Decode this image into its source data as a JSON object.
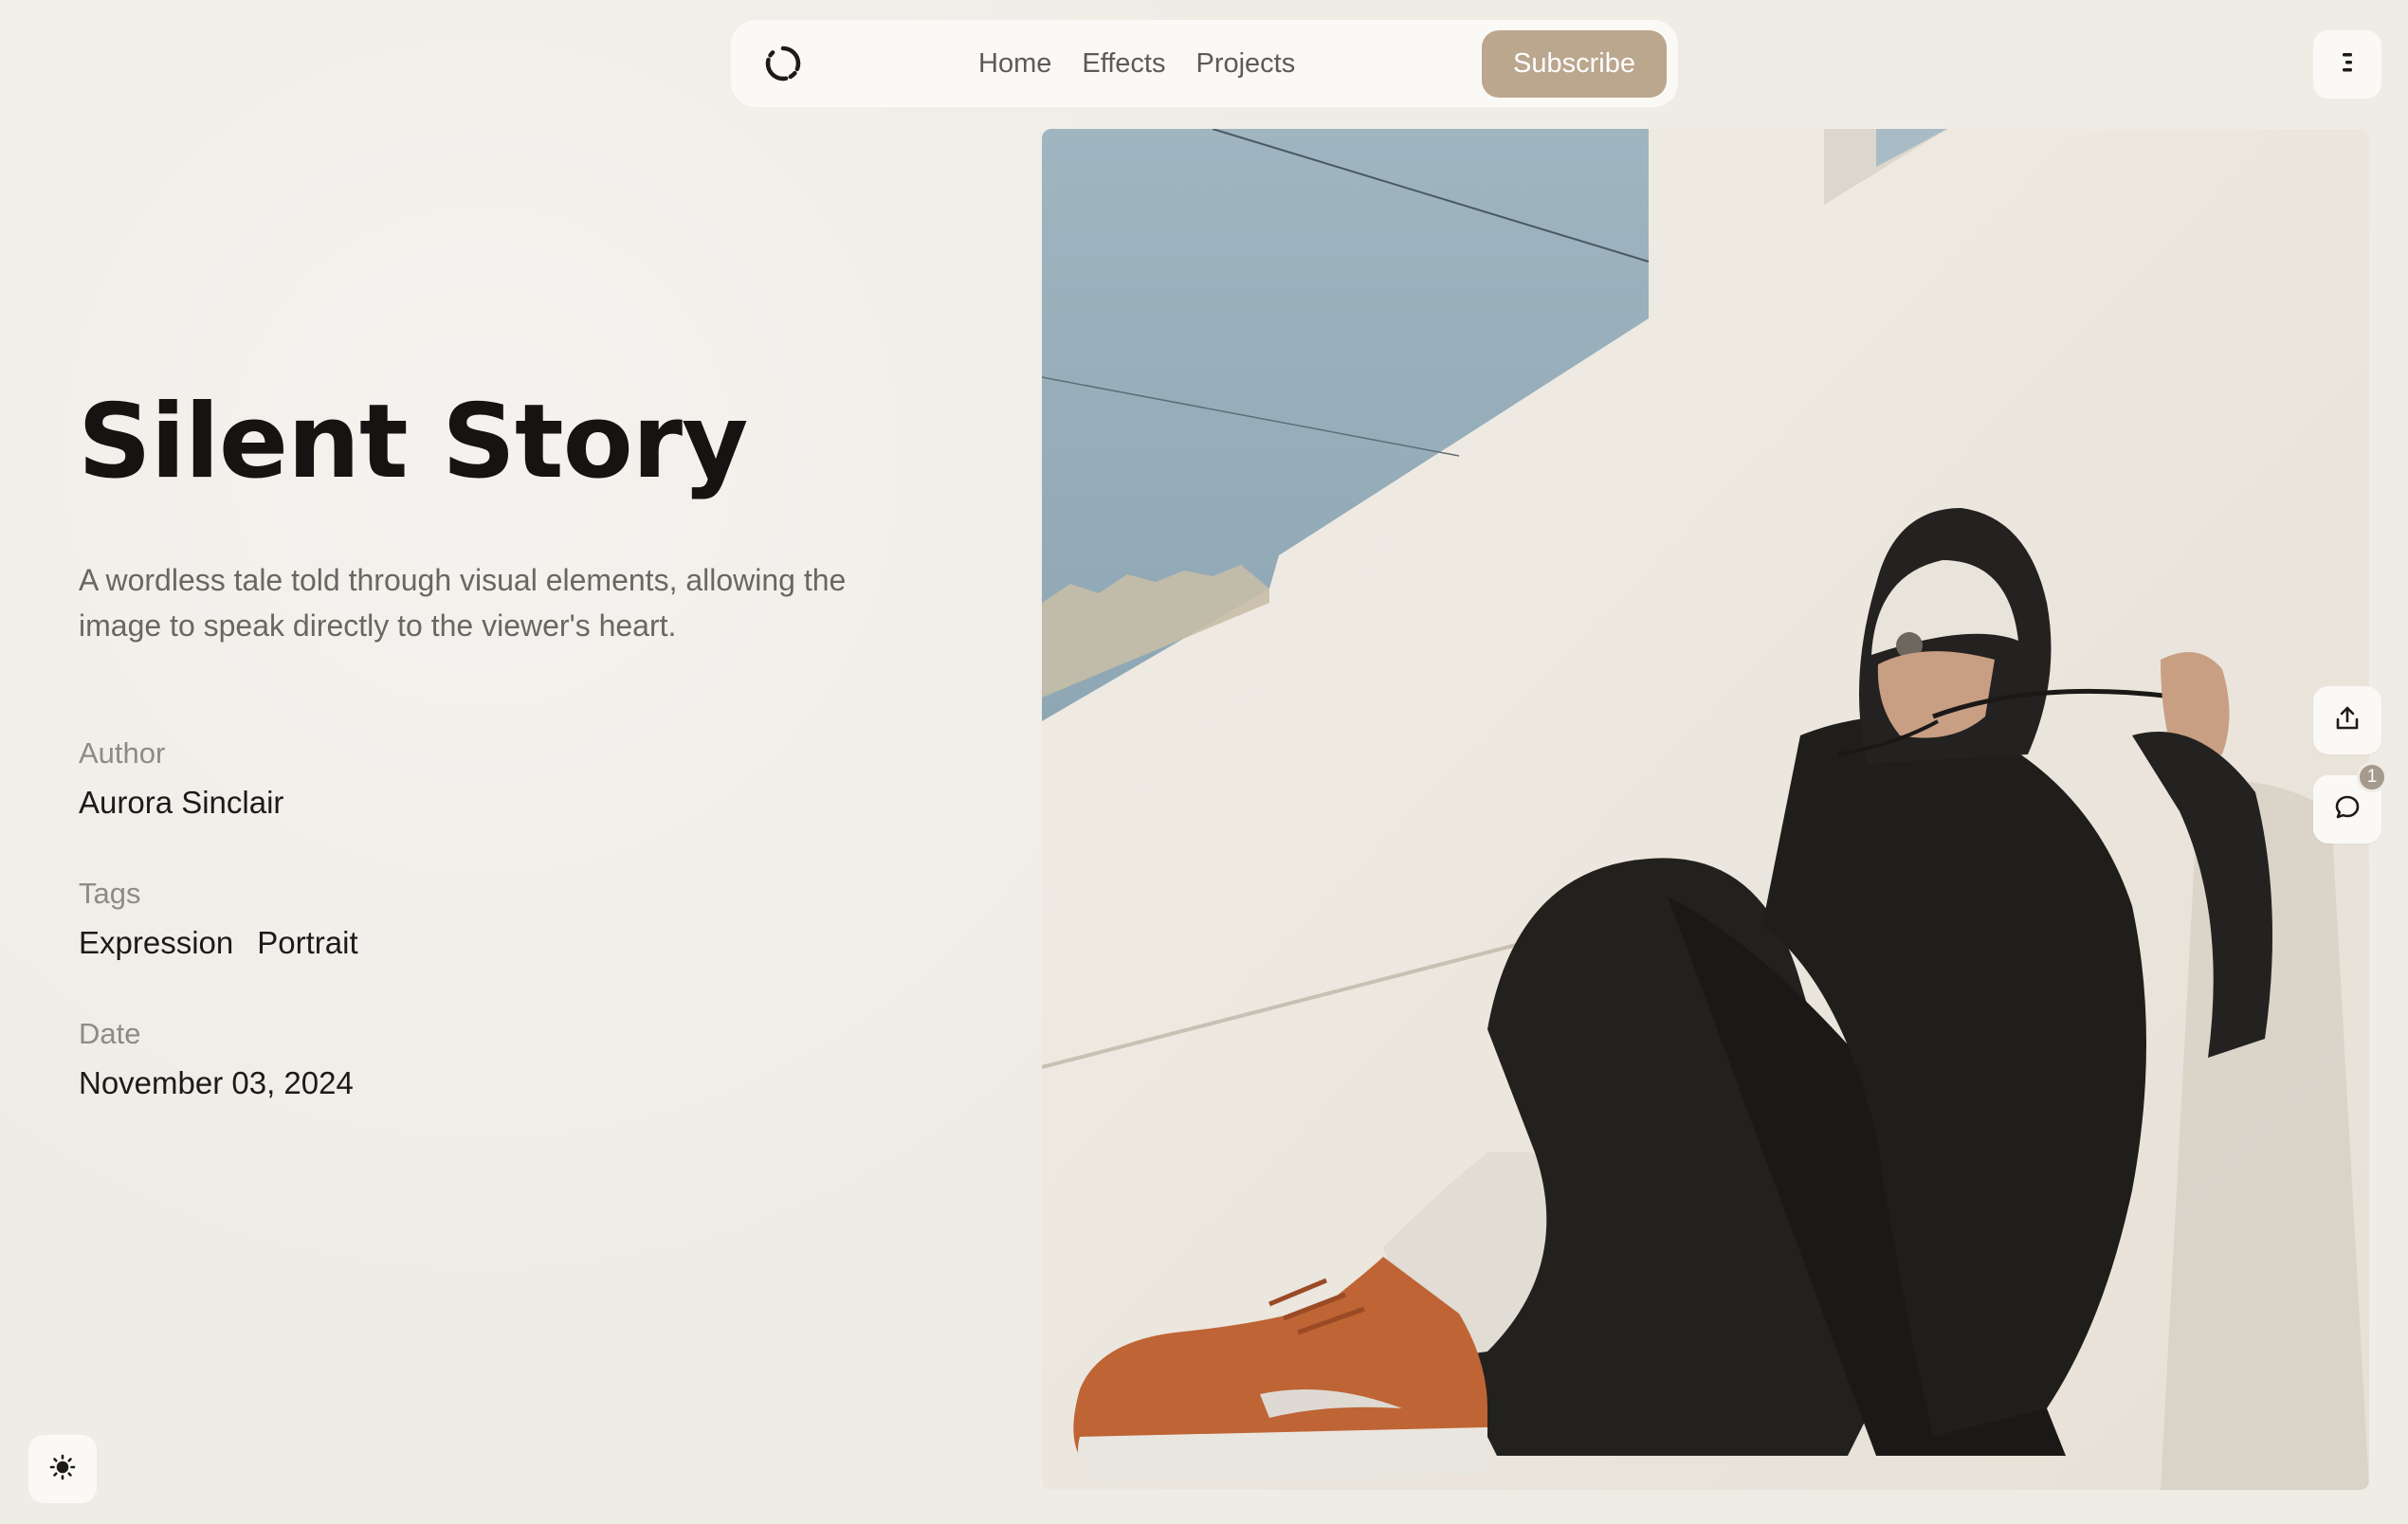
{
  "nav": {
    "logo_icon": "loading-ring-icon",
    "links": [
      {
        "label": "Home"
      },
      {
        "label": "Effects"
      },
      {
        "label": "Projects"
      }
    ],
    "subscribe_label": "Subscribe",
    "menu_icon": "menu-icon"
  },
  "article": {
    "title": "Silent Story",
    "description": "A wordless tale told through visual elements, allowing the image to speak directly to the viewer's heart.",
    "author_label": "Author",
    "author": "Aurora Sinclair",
    "tags_label": "Tags",
    "tags": [
      "Expression",
      "Portrait"
    ],
    "date_label": "Date",
    "date": "November 03, 2024"
  },
  "actions": {
    "share_icon": "share-icon",
    "comment_icon": "comment-icon",
    "comment_count": "1",
    "theme_icon": "sun-icon"
  },
  "colors": {
    "background": "#efece6",
    "accent": "#bba68e",
    "text_primary": "#151412",
    "text_muted": "#8f8a83"
  }
}
